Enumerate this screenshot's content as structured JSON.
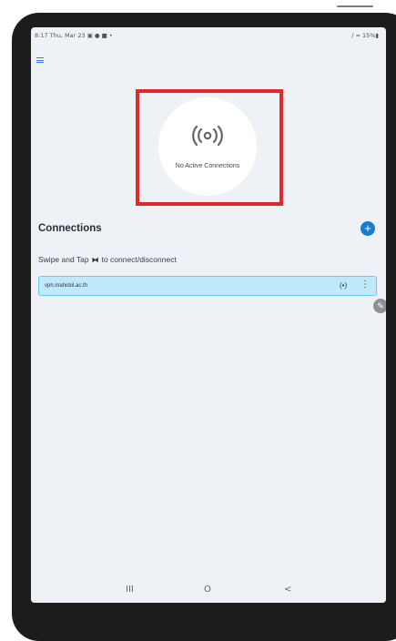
{
  "status_bar": {
    "time": "8:17  Thu, Mar 23",
    "icons": "▣ ● ■ •",
    "right": "∕ ≈ 15%▮"
  },
  "header": {
    "menu_icon": "menu-icon"
  },
  "status_panel": {
    "icon": "broadcast-icon",
    "label": "No Active Connections"
  },
  "connections": {
    "title": "Connections",
    "add_label": "+",
    "hint_prefix": "Swipe and Tap",
    "hint_icon": "⧓",
    "hint_suffix": "to connect/disconnect",
    "items": [
      {
        "name": "vpn.mahidol.ac.th",
        "signal_icon": "(•)",
        "more_icon": "⋮"
      }
    ]
  },
  "edit_fab": {
    "icon": "✎"
  },
  "nav": {
    "recent": "III",
    "home": "O",
    "back": "<"
  },
  "colors": {
    "highlight": "#e5262b",
    "accent": "#1a7bd1",
    "card_bg": "#bde9fb",
    "card_border": "#6ccaf0"
  }
}
